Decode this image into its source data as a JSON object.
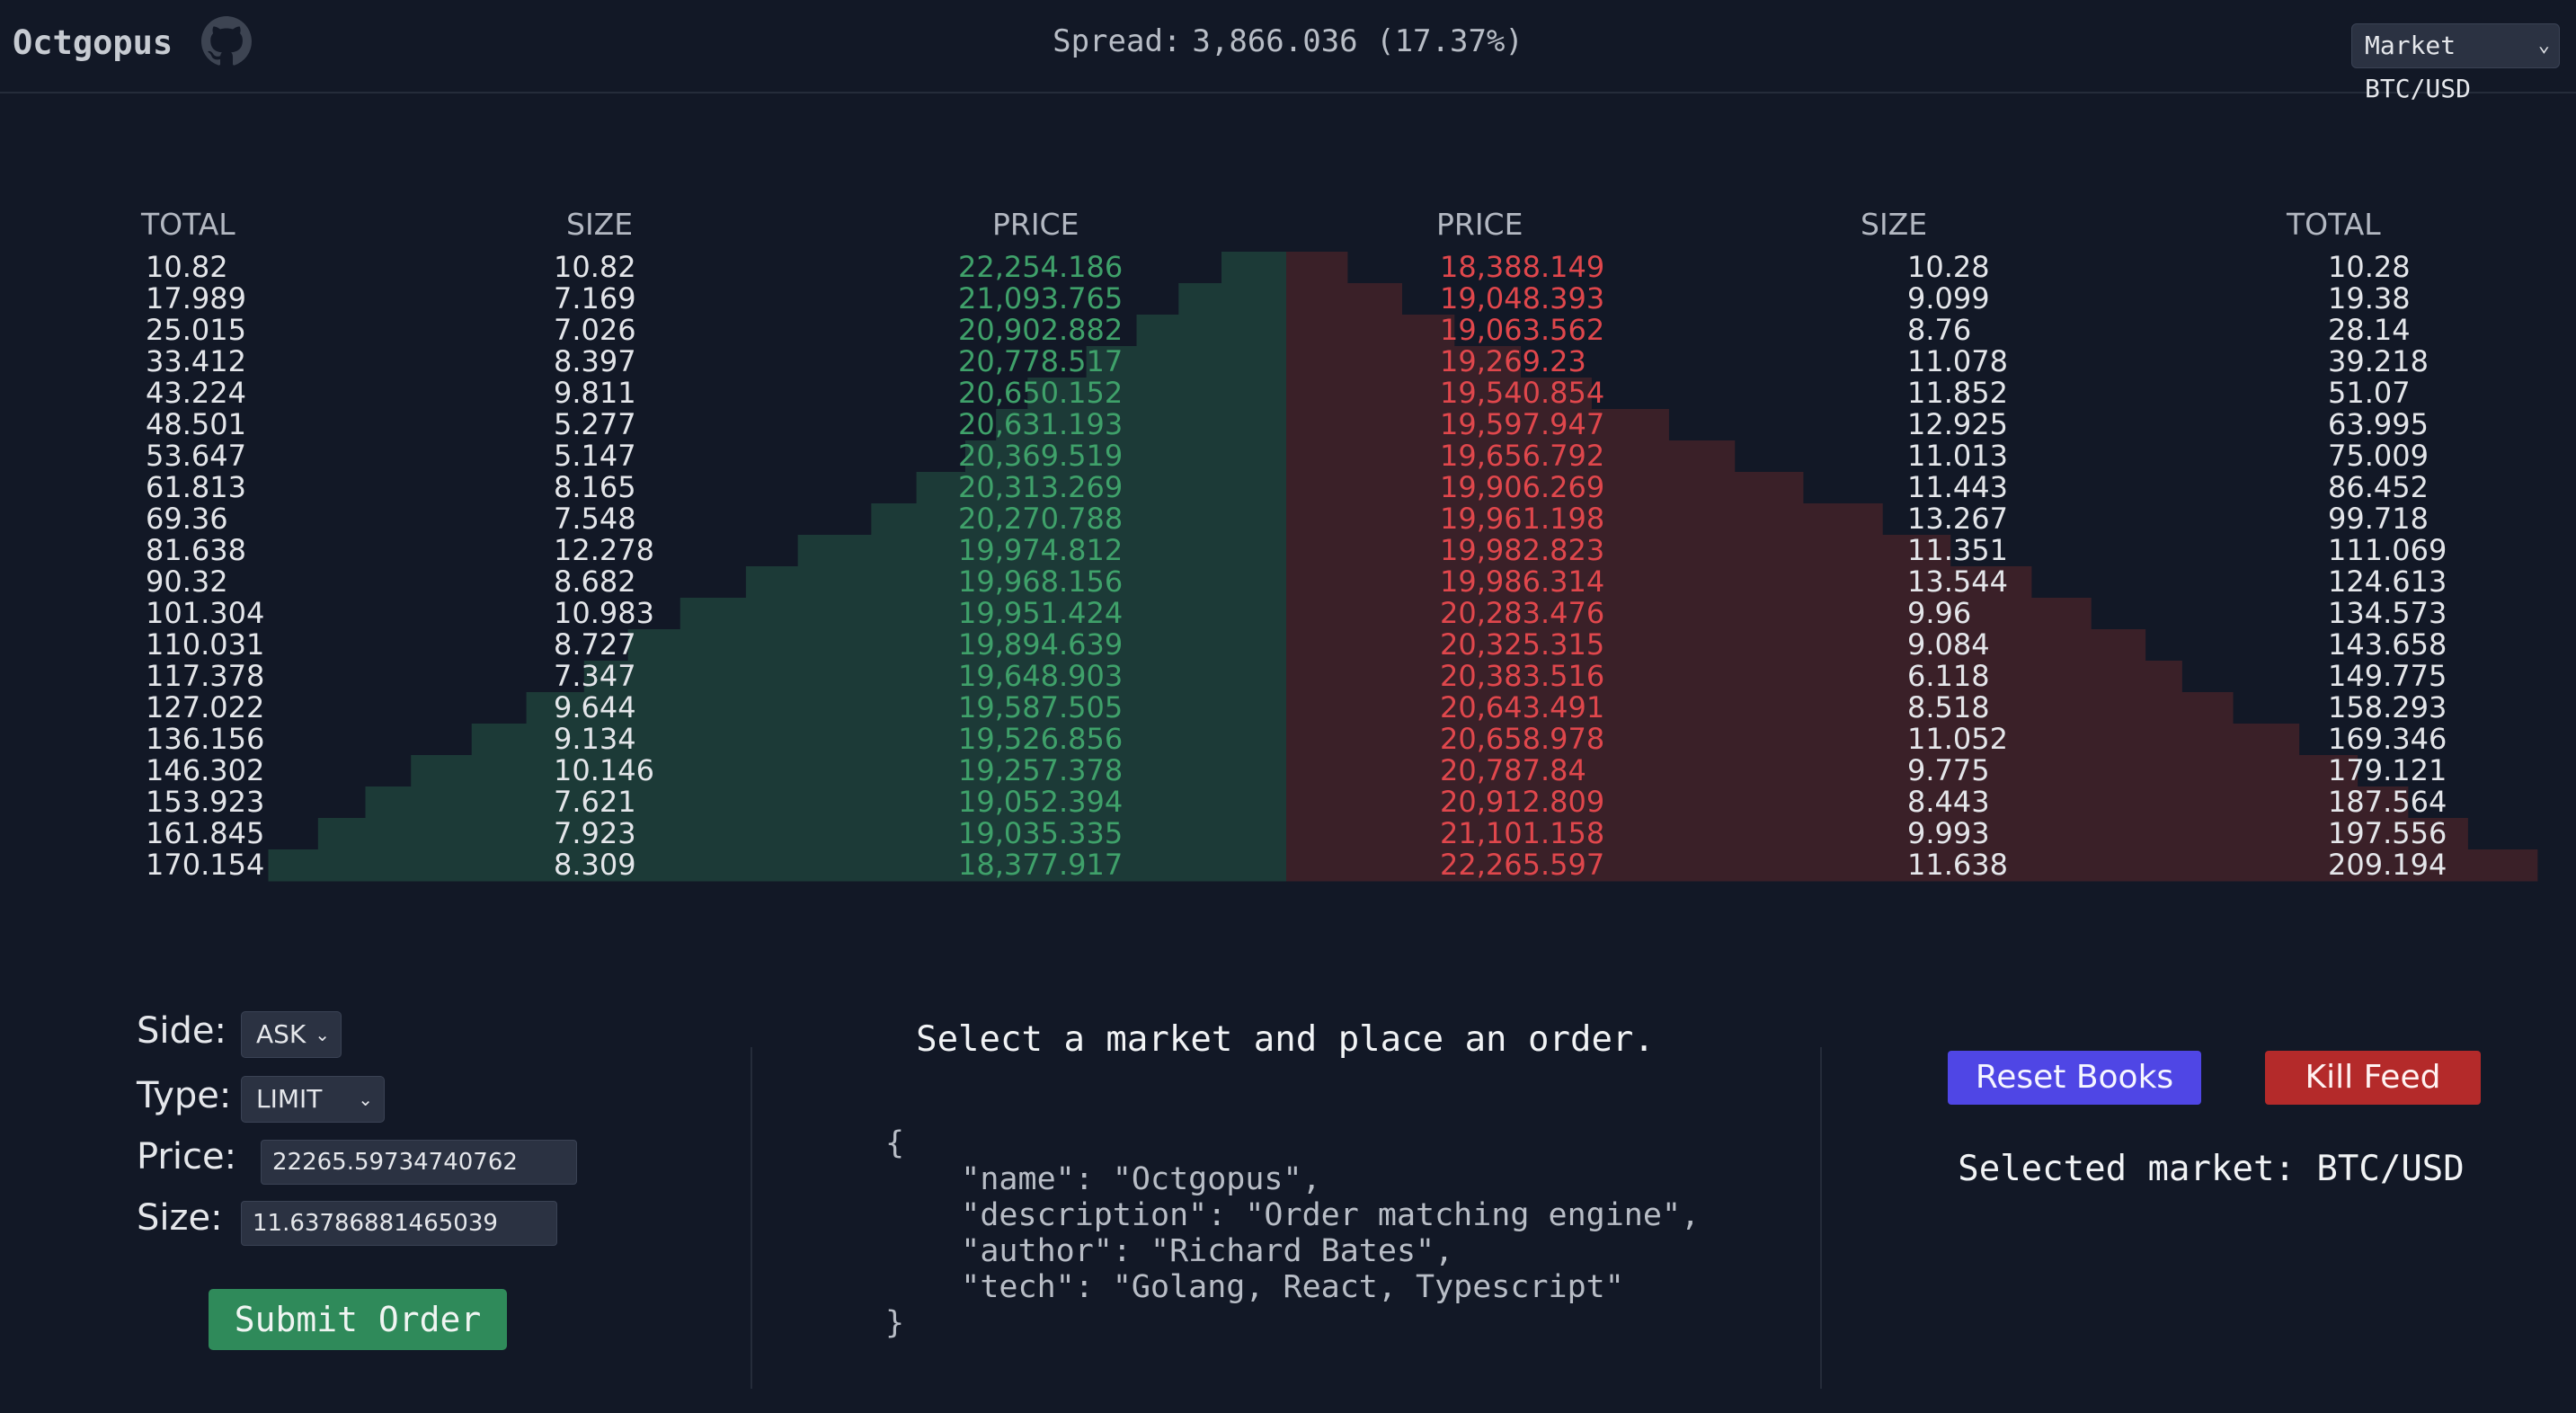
{
  "header": {
    "brand": "Octgopus",
    "spread_label": "Spread:",
    "spread_value": "3,866.036 (17.37%)",
    "market_select_value": "Market BTC/USD"
  },
  "orderbook": {
    "bids_headers": {
      "total": "TOTAL",
      "size": "SIZE",
      "price": "PRICE"
    },
    "asks_headers": {
      "price": "PRICE",
      "size": "SIZE",
      "total": "TOTAL"
    },
    "bids": [
      {
        "total": "10.82",
        "size": "10.82",
        "price": "22,254.186"
      },
      {
        "total": "17.989",
        "size": "7.169",
        "price": "21,093.765"
      },
      {
        "total": "25.015",
        "size": "7.026",
        "price": "20,902.882"
      },
      {
        "total": "33.412",
        "size": "8.397",
        "price": "20,778.517"
      },
      {
        "total": "43.224",
        "size": "9.811",
        "price": "20,650.152"
      },
      {
        "total": "48.501",
        "size": "5.277",
        "price": "20,631.193"
      },
      {
        "total": "53.647",
        "size": "5.147",
        "price": "20,369.519"
      },
      {
        "total": "61.813",
        "size": "8.165",
        "price": "20,313.269"
      },
      {
        "total": "69.36",
        "size": "7.548",
        "price": "20,270.788"
      },
      {
        "total": "81.638",
        "size": "12.278",
        "price": "19,974.812"
      },
      {
        "total": "90.32",
        "size": "8.682",
        "price": "19,968.156"
      },
      {
        "total": "101.304",
        "size": "10.983",
        "price": "19,951.424"
      },
      {
        "total": "110.031",
        "size": "8.727",
        "price": "19,894.639"
      },
      {
        "total": "117.378",
        "size": "7.347",
        "price": "19,648.903"
      },
      {
        "total": "127.022",
        "size": "9.644",
        "price": "19,587.505"
      },
      {
        "total": "136.156",
        "size": "9.134",
        "price": "19,526.856"
      },
      {
        "total": "146.302",
        "size": "10.146",
        "price": "19,257.378"
      },
      {
        "total": "153.923",
        "size": "7.621",
        "price": "19,052.394"
      },
      {
        "total": "161.845",
        "size": "7.923",
        "price": "19,035.335"
      },
      {
        "total": "170.154",
        "size": "8.309",
        "price": "18,377.917"
      }
    ],
    "asks": [
      {
        "price": "18,388.149",
        "size": "10.28",
        "total": "10.28"
      },
      {
        "price": "19,048.393",
        "size": "9.099",
        "total": "19.38"
      },
      {
        "price": "19,063.562",
        "size": "8.76",
        "total": "28.14"
      },
      {
        "price": "19,269.23",
        "size": "11.078",
        "total": "39.218"
      },
      {
        "price": "19,540.854",
        "size": "11.852",
        "total": "51.07"
      },
      {
        "price": "19,597.947",
        "size": "12.925",
        "total": "63.995"
      },
      {
        "price": "19,656.792",
        "size": "11.013",
        "total": "75.009"
      },
      {
        "price": "19,906.269",
        "size": "11.443",
        "total": "86.452"
      },
      {
        "price": "19,961.198",
        "size": "13.267",
        "total": "99.718"
      },
      {
        "price": "19,982.823",
        "size": "11.351",
        "total": "111.069"
      },
      {
        "price": "19,986.314",
        "size": "13.544",
        "total": "124.613"
      },
      {
        "price": "20,283.476",
        "size": "9.96",
        "total": "134.573"
      },
      {
        "price": "20,325.315",
        "size": "9.084",
        "total": "143.658"
      },
      {
        "price": "20,383.516",
        "size": "6.118",
        "total": "149.775"
      },
      {
        "price": "20,643.491",
        "size": "8.518",
        "total": "158.293"
      },
      {
        "price": "20,658.978",
        "size": "11.052",
        "total": "169.346"
      },
      {
        "price": "20,787.84",
        "size": "9.775",
        "total": "179.121"
      },
      {
        "price": "20,912.809",
        "size": "8.443",
        "total": "187.564"
      },
      {
        "price": "21,101.158",
        "size": "9.993",
        "total": "197.556"
      },
      {
        "price": "22,265.597",
        "size": "11.638",
        "total": "209.194"
      }
    ],
    "max_total": 215,
    "colors": {
      "bid_fill": "#1c3a37",
      "ask_fill": "#3a2028",
      "bid_text": "#3fa16a",
      "ask_text": "#e0474c"
    }
  },
  "order_form": {
    "side_label": "Side:",
    "side_value": "ASK",
    "type_label": "Type:",
    "type_value": "LIMIT",
    "price_label": "Price:",
    "price_value": "22265.59734740762",
    "size_label": "Size:",
    "size_value": "11.63786881465039",
    "submit_label": "Submit Order"
  },
  "center": {
    "message": "Select a market and place an order.",
    "json_lines": [
      "{",
      "    \"name\": \"Octgopus\",",
      "    \"description\": \"Order matching engine\",",
      "    \"author\": \"Richard Bates\",",
      "    \"tech\": \"Golang, React, Typescript\"",
      "}"
    ]
  },
  "controls": {
    "reset_label": "Reset Books",
    "kill_label": "Kill Feed",
    "selected_market_text": "Selected market: BTC/USD"
  }
}
